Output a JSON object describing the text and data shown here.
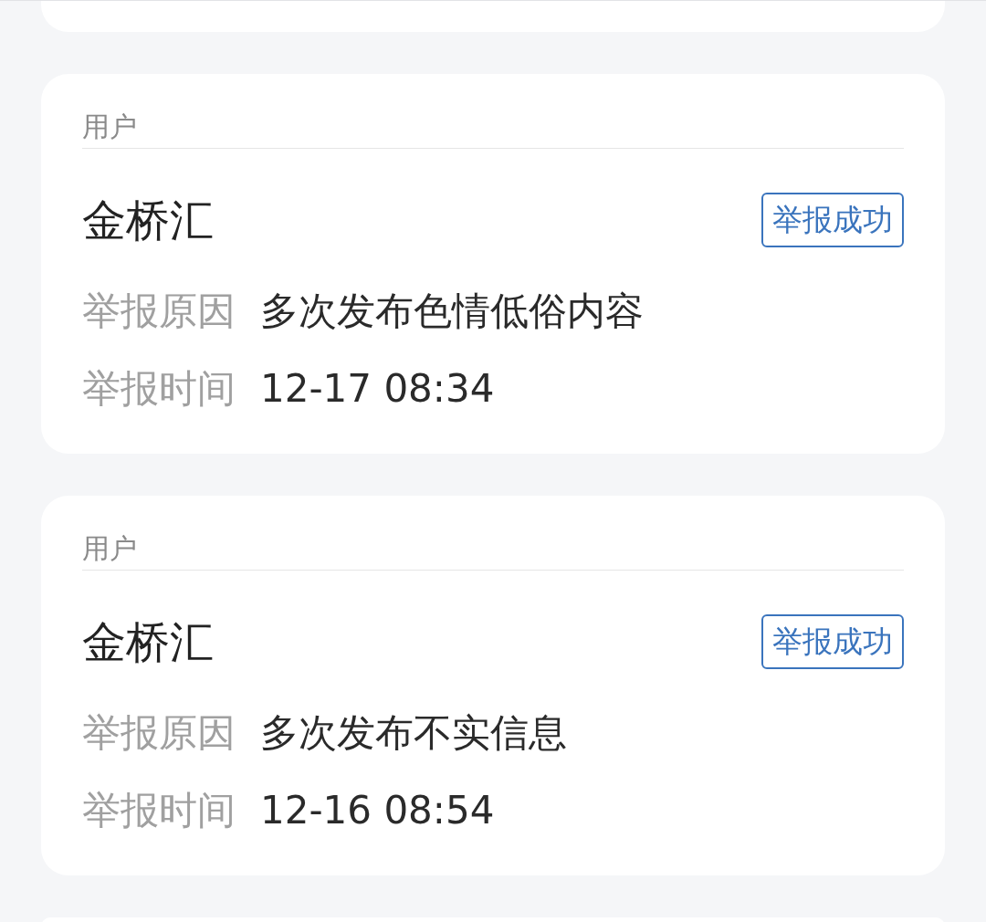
{
  "reports": [
    {
      "section_label": "用户",
      "name": "金桥汇",
      "status": "举报成功",
      "fields": [
        {
          "label": "举报原因",
          "value": "多次发布色情低俗内容"
        },
        {
          "label": "举报时间",
          "value": "12-17 08:34"
        }
      ]
    },
    {
      "section_label": "用户",
      "name": "金桥汇",
      "status": "举报成功",
      "fields": [
        {
          "label": "举报原因",
          "value": "多次发布不实信息"
        },
        {
          "label": "举报时间",
          "value": "12-16 08:54"
        }
      ]
    }
  ]
}
